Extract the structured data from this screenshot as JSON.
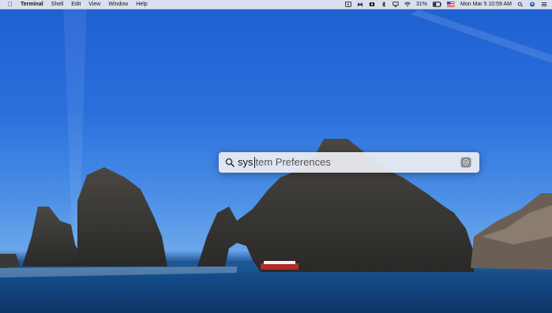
{
  "menubar": {
    "app_name": "Terminal",
    "menus": [
      "Shell",
      "Edit",
      "View",
      "Window",
      "Help"
    ],
    "battery_percent": "31%",
    "datetime": "Mon Mar 5  10:59 AM",
    "tray_icons": [
      "screen-record-icon",
      "malwarebytes-icon",
      "cloud-app-icon",
      "bluetooth-icon",
      "airplay-icon",
      "wifi-icon",
      "battery-icon",
      "us-flag-icon",
      "search-icon",
      "user-icon",
      "list-icon"
    ]
  },
  "spotlight": {
    "typed_text": "sys",
    "completion_text": "tem Preferences",
    "result_icon": "system-preferences-icon"
  },
  "colors": {
    "sky_top": "#1f5fd0",
    "sea": "#123f78",
    "rock": "#3c3a38",
    "menubar_bg": "#e8ecf2"
  }
}
